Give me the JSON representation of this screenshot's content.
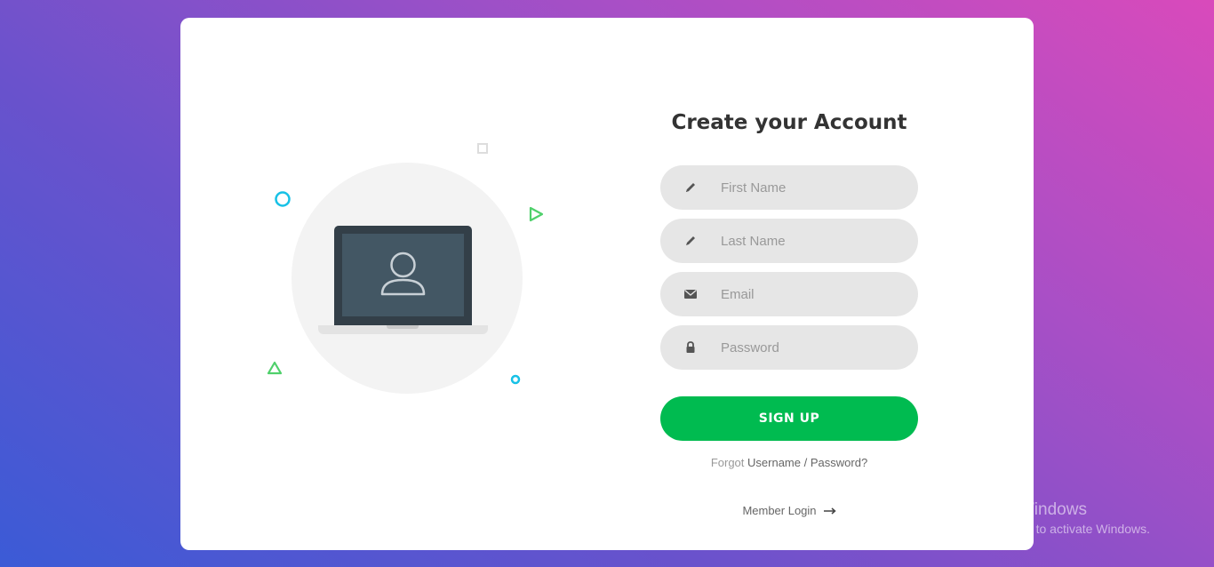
{
  "form": {
    "title": "Create your Account",
    "fields": [
      {
        "placeholder": "First Name",
        "icon": "pencil-icon"
      },
      {
        "placeholder": "Last Name",
        "icon": "pencil-icon"
      },
      {
        "placeholder": "Email",
        "icon": "envelope-icon"
      },
      {
        "placeholder": "Password",
        "icon": "lock-icon"
      }
    ],
    "signup_label": "SIGN UP",
    "forgot_prefix": "Forgot",
    "forgot_username": "Username",
    "forgot_sep": "/",
    "forgot_password": "Password?",
    "member_login": "Member Login"
  },
  "watermark": {
    "line1": "Activate Windows",
    "line2": "Go to Settings to activate Windows."
  },
  "colors": {
    "accent": "#00bb50",
    "field_bg": "#e6e6e6",
    "title": "#333333"
  }
}
